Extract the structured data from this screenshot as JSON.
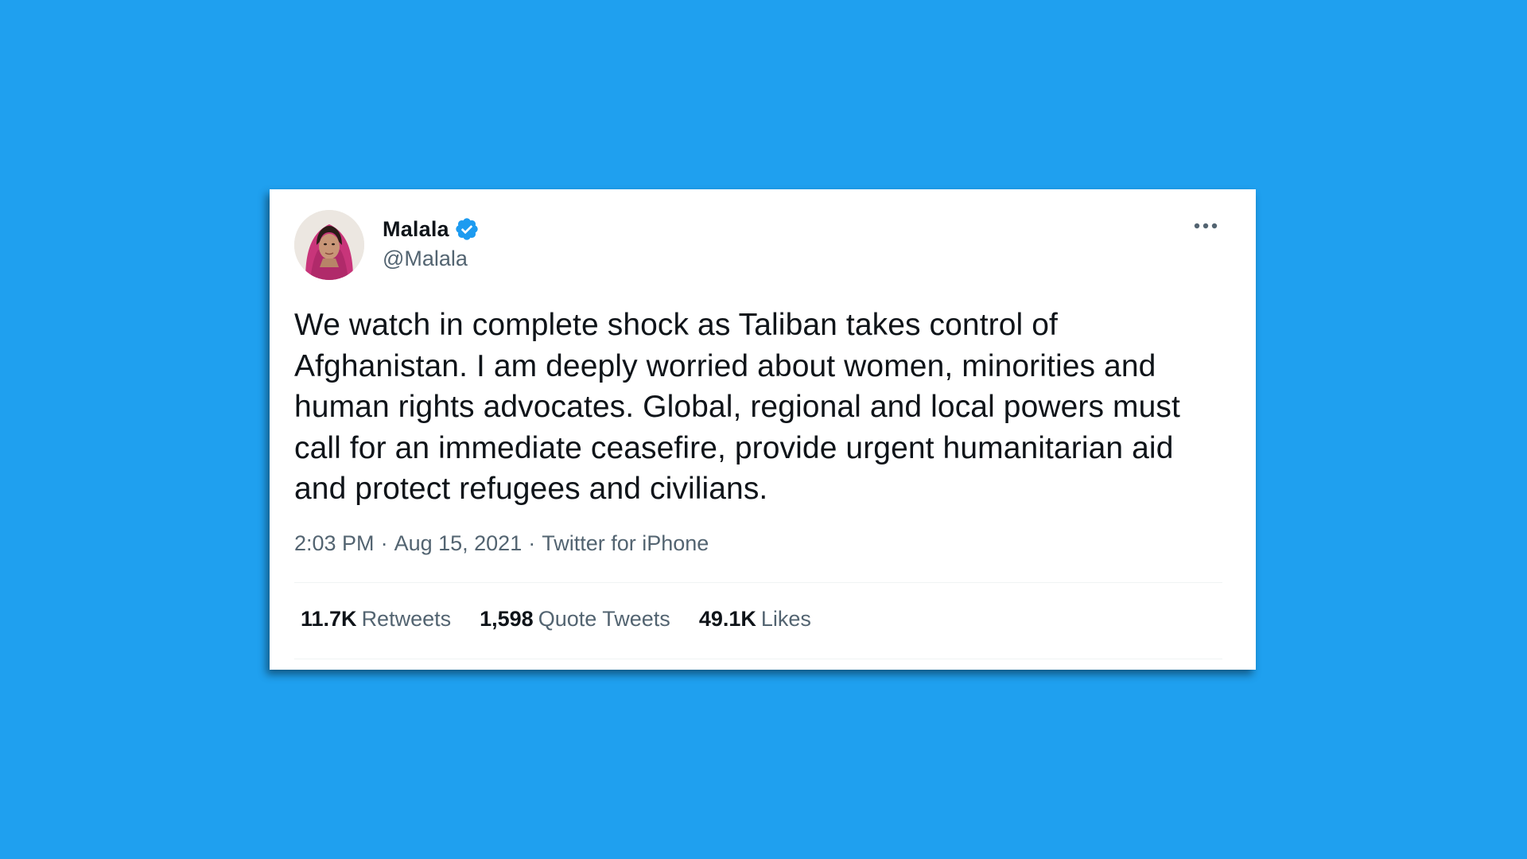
{
  "colors": {
    "background": "#1fa0ef",
    "card": "#ffffff",
    "text_primary": "#0f1419",
    "text_secondary": "#536471",
    "verified_badge": "#1d9bf0"
  },
  "author": {
    "display_name": "Malala",
    "handle": "@Malala",
    "verified": true,
    "avatar_icon": "profile-photo"
  },
  "menu": {
    "icon": "more-horizontal-icon"
  },
  "tweet": {
    "text": "We watch in complete shock as Taliban takes control of Afghanistan. I am deeply worried about women, minorities and human rights advocates. Global, regional and local powers must call for an immediate ceasefire, provide urgent humanitarian aid and protect refugees and civilians.",
    "time": "2:03 PM",
    "date": "Aug 15, 2021",
    "source": "Twitter for iPhone",
    "separator": "·"
  },
  "stats": {
    "retweets": {
      "count": "11.7K",
      "label": "Retweets"
    },
    "quotes": {
      "count": "1,598",
      "label": "Quote Tweets"
    },
    "likes": {
      "count": "49.1K",
      "label": "Likes"
    }
  }
}
